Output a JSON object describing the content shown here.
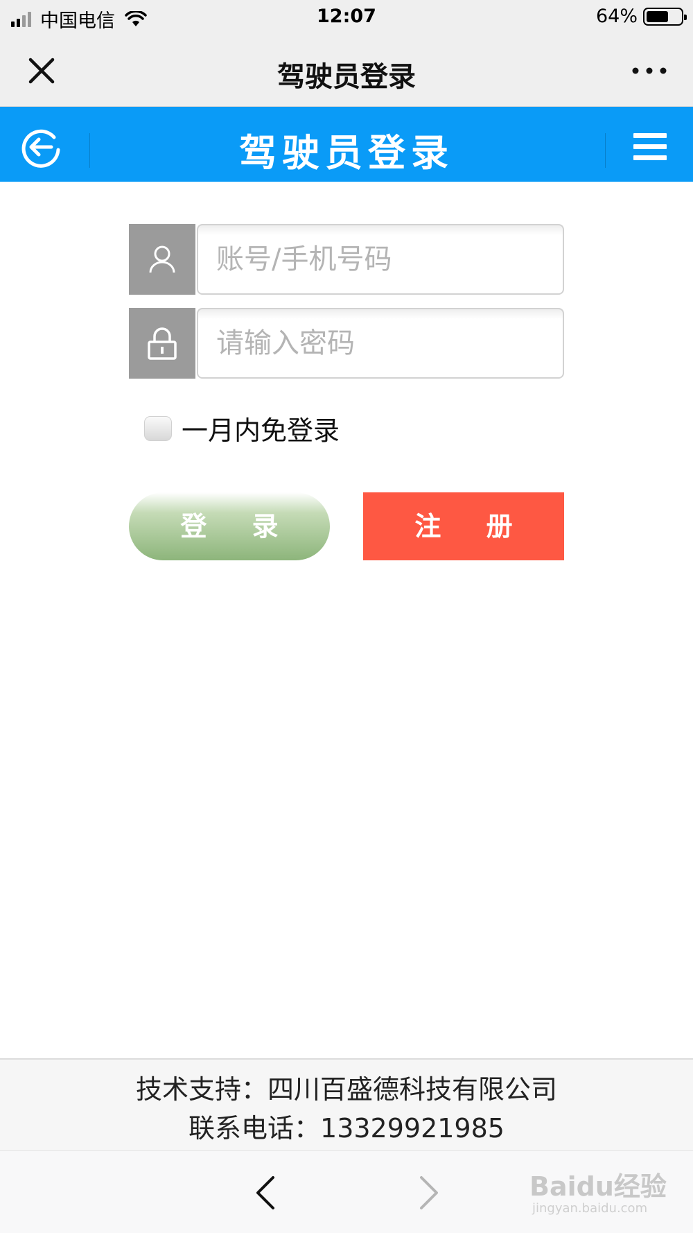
{
  "status_bar": {
    "carrier": "中国电信",
    "time": "12:07",
    "battery": "64%",
    "battery_level": 0.64
  },
  "wechat_nav": {
    "title": "驾驶员登录",
    "close_icon": "close-icon",
    "more_icon": "more-icon"
  },
  "header": {
    "title": "驾驶员登录",
    "back_icon": "back-circle-icon",
    "menu_icon": "menu-icon",
    "background": "#0a9bf7"
  },
  "form": {
    "username_placeholder": "账号/手机号码",
    "password_placeholder": "请输入密码",
    "remember_label": "一月内免登录",
    "login_label": "登 录",
    "register_label": "注 册",
    "login_color": "#8db57b",
    "register_color": "#fe5843"
  },
  "footer": {
    "support": "技术支持：四川百盛德科技有限公司",
    "phone": "联系电话：13329921985"
  },
  "bottom_nav": {
    "back_icon": "chevron-left-icon",
    "forward_icon": "chevron-right-icon"
  },
  "watermark": {
    "brand": "Baidu经验",
    "url": "jingyan.baidu.com"
  }
}
